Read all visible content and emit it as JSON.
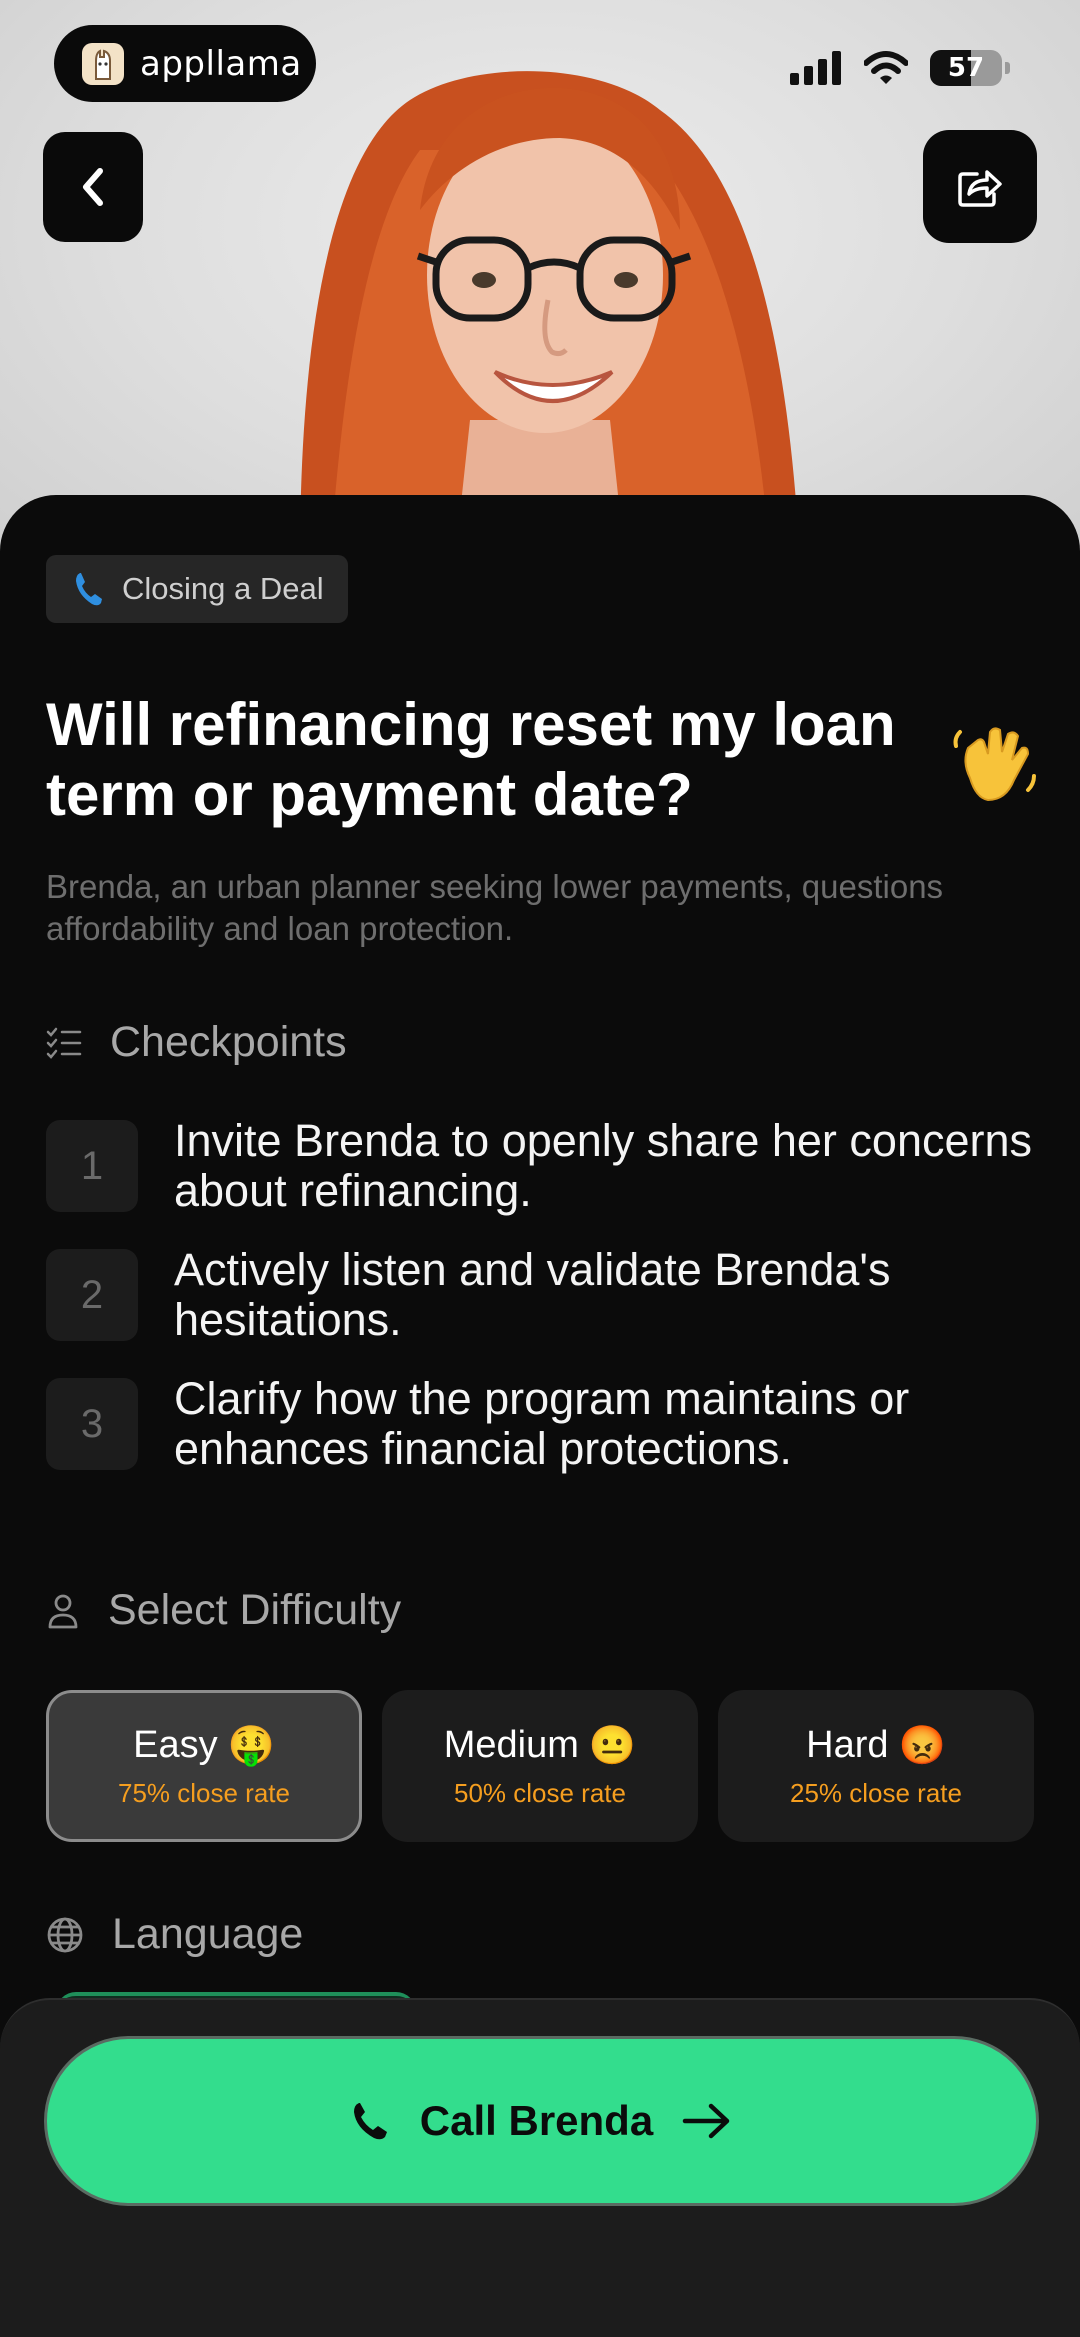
{
  "status_bar": {
    "brand_name": "appllama",
    "battery_level": "57",
    "battery_fraction": 0.57
  },
  "header": {
    "back_icon": "chevron-left-icon",
    "share_icon": "share-icon"
  },
  "scenario": {
    "category_icon": "phone-icon",
    "category": "Closing a Deal",
    "title": "Will refinancing reset my loan term or payment date?",
    "title_emoji": "👋",
    "description": "Brenda, an urban planner seeking lower payments, questions affordability and loan protection."
  },
  "checkpoints": {
    "heading": "Checkpoints",
    "items": [
      {
        "number": "1",
        "text": "Invite Brenda to openly share her concerns about refinancing."
      },
      {
        "number": "2",
        "text": "Actively listen and validate Brenda's hesitations."
      },
      {
        "number": "3",
        "text": "Clarify how the program maintains or enhances financial protections."
      }
    ]
  },
  "difficulty": {
    "heading": "Select Difficulty",
    "options": [
      {
        "label": "Easy",
        "emoji": "🤑",
        "rate": "75% close rate",
        "selected": true
      },
      {
        "label": "Medium",
        "emoji": "😐",
        "rate": "50% close rate",
        "selected": false
      },
      {
        "label": "Hard",
        "emoji": "😡",
        "rate": "25% close rate",
        "selected": false
      }
    ]
  },
  "language": {
    "heading": "Language"
  },
  "call_button": {
    "label": "Call Brenda"
  },
  "colors": {
    "accent_green": "#33dd8d",
    "rate_orange": "#f59e1f",
    "background": "#0b0b0b"
  }
}
